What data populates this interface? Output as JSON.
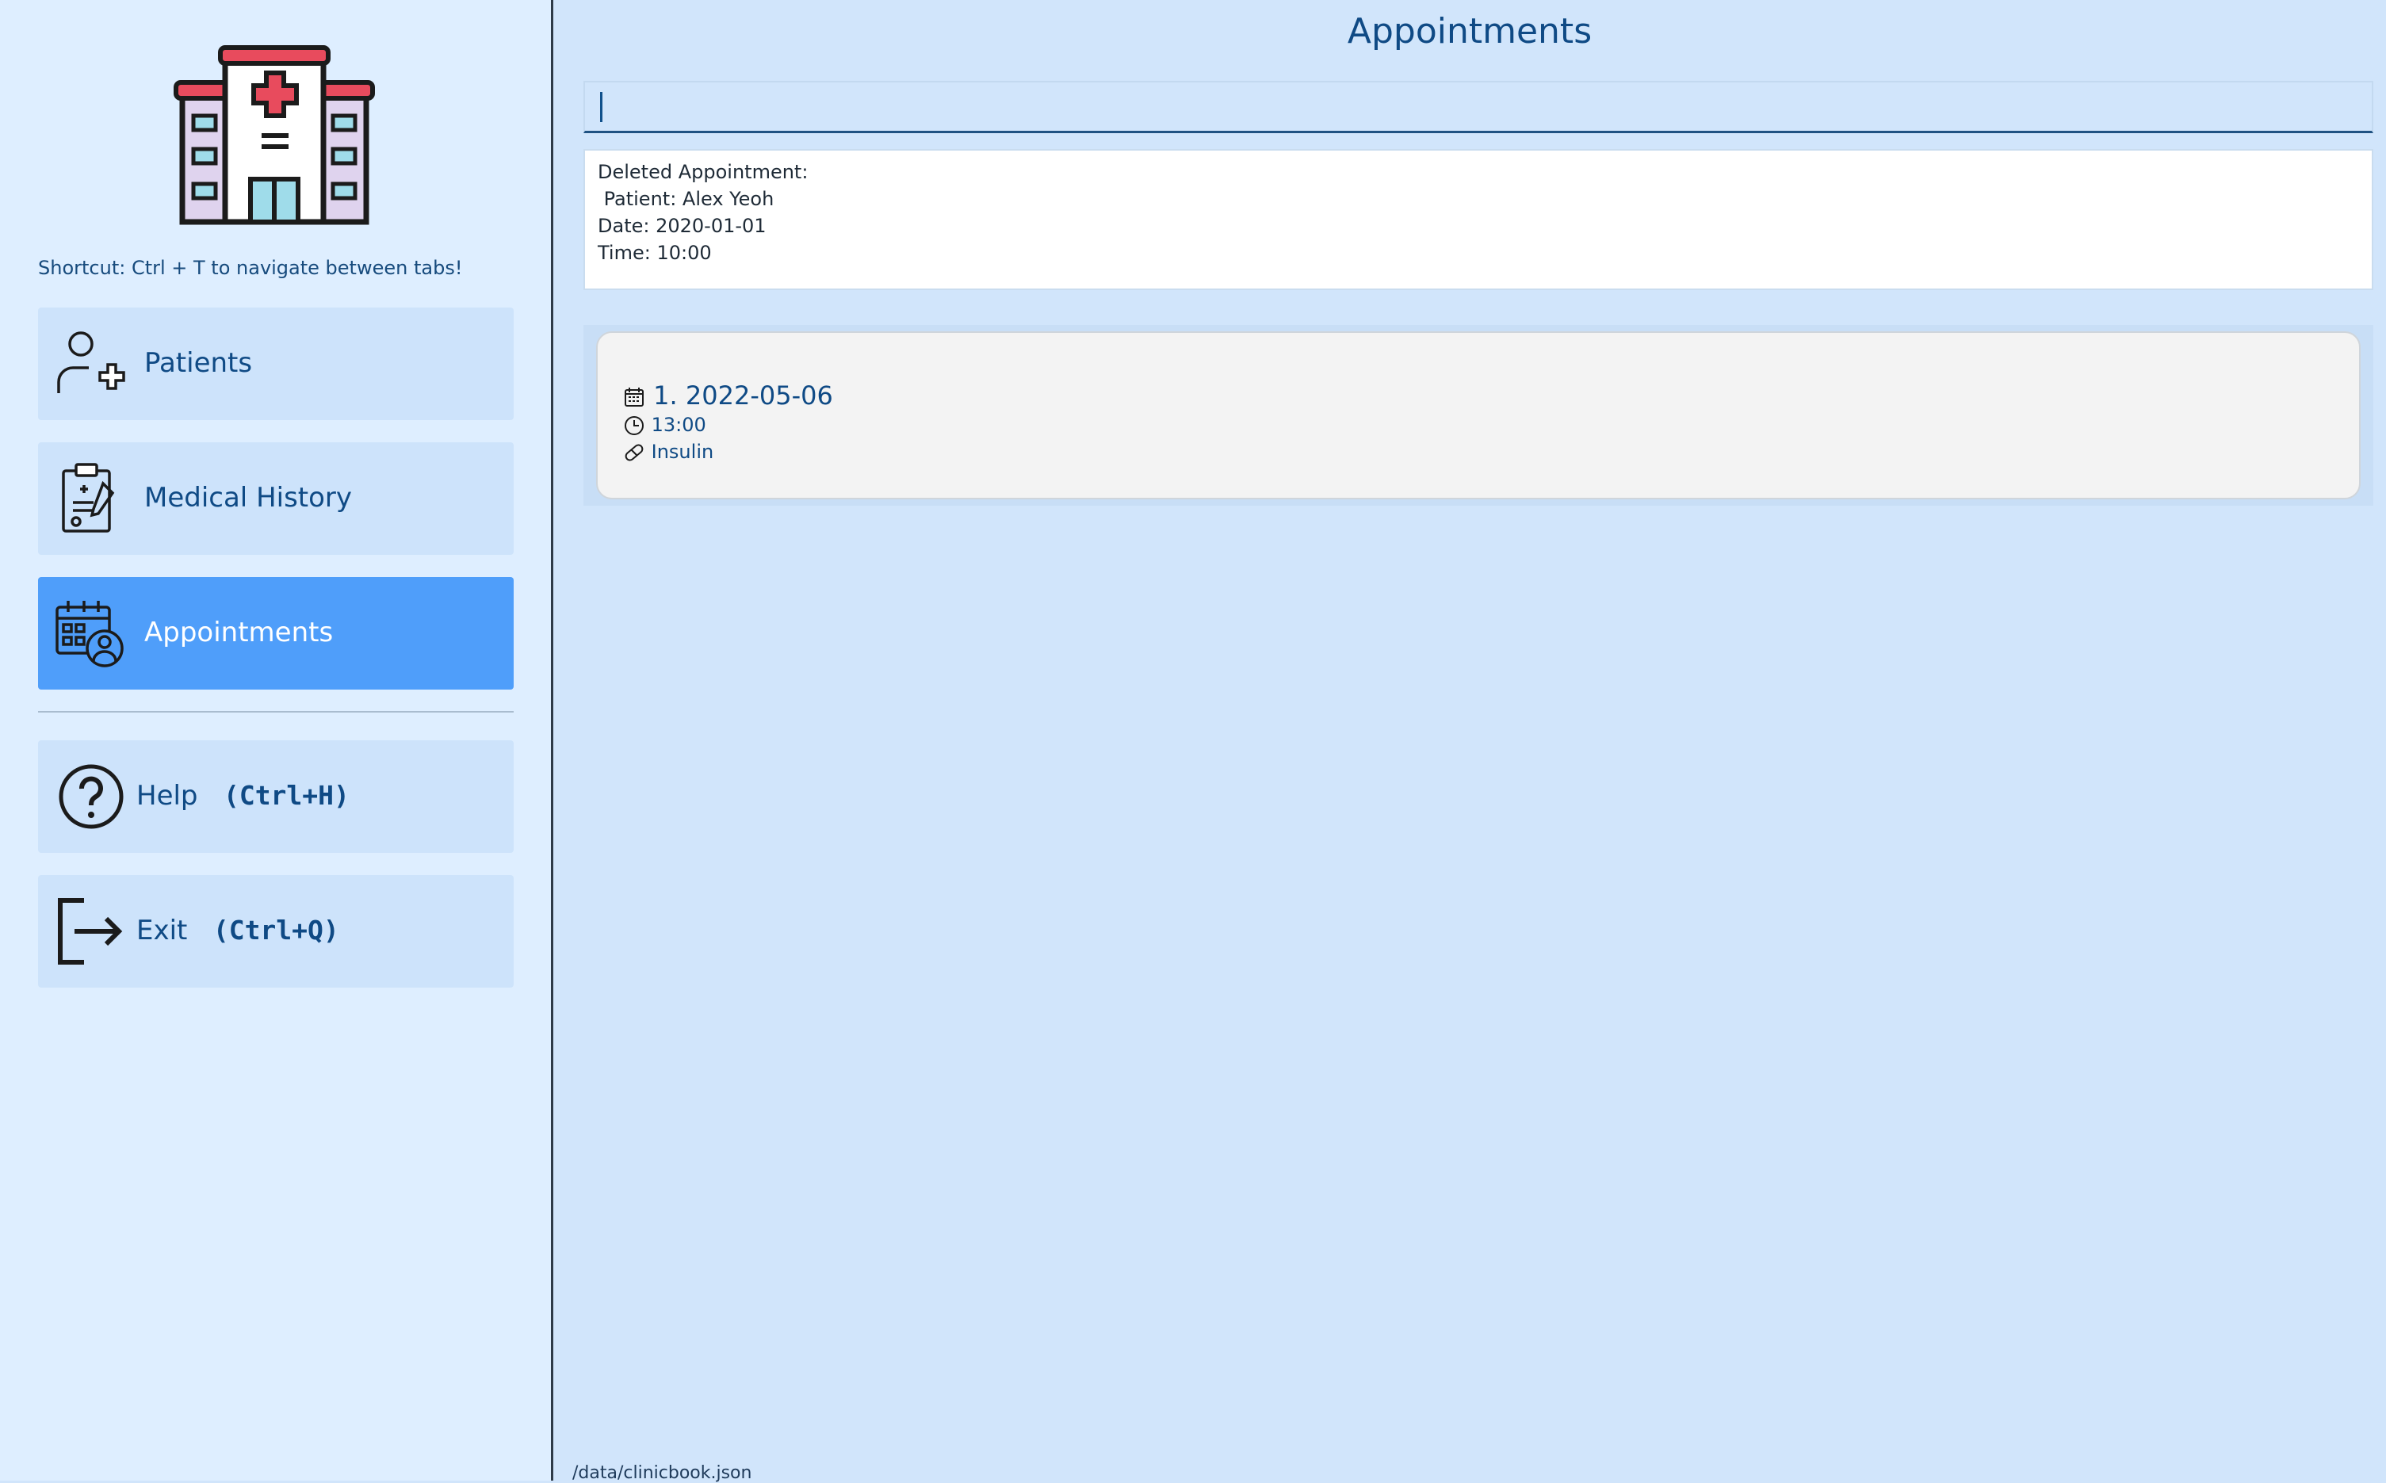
{
  "sidebar": {
    "shortcut_text": "Shortcut: Ctrl + T to navigate between tabs!",
    "items": [
      {
        "label": "Patients",
        "icon": "add-patient-icon",
        "active": false
      },
      {
        "label": "Medical History",
        "icon": "clipboard-icon",
        "active": false
      },
      {
        "label": "Appointments",
        "icon": "calendar-doctor-icon",
        "active": true
      }
    ],
    "help": {
      "label": "Help",
      "key": "(Ctrl+H)",
      "icon": "question-circle-icon"
    },
    "exit": {
      "label": "Exit",
      "key": "(Ctrl+Q)",
      "icon": "exit-icon"
    }
  },
  "main": {
    "title": "Appointments",
    "command_input": {
      "value": "",
      "placeholder": ""
    },
    "result": {
      "lines": [
        "Deleted Appointment:",
        " Patient: Alex Yeoh",
        "Date: 2020-01-01",
        "Time: 10:00"
      ]
    },
    "appointments": [
      {
        "index_date": "1. 2022-05-06",
        "time": "13:00",
        "medication": "Insulin"
      }
    ]
  },
  "status_bar": {
    "path": "/data/clinicbook.json"
  },
  "colors": {
    "sidebar_bg": "#deeeff",
    "main_bg": "#d1e5fb",
    "button_bg": "#cde3fb",
    "active_button_bg": "#4f9efa",
    "text_primary": "#0f4a85"
  }
}
